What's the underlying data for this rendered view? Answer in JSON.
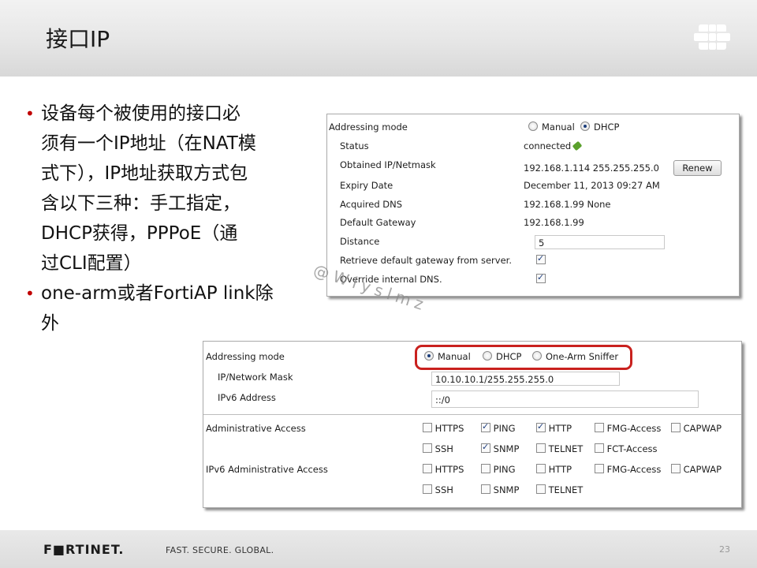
{
  "slide": {
    "title": "接口IP",
    "bullets": [
      "设备每个被使用的接口必须有一个IP地址（在NAT模式下），IP地址获取方式包含以下三种：手工指定，DHCP获得，PPPoE（通过CLI配置）",
      "one-arm或者FortiAP link除外"
    ],
    "bullet_lines": [
      [
        "设备每个被使用的接口必",
        "须有一个IP地址（在NAT模",
        "式下），IP地址获取方式包",
        "含以下三种：手工指定，",
        "DHCP获得，PPPoE（通",
        "过CLI配置）"
      ],
      [
        "one-arm或者FortiAP link除",
        "外"
      ]
    ],
    "watermark": "@Wlyslmz",
    "footer": {
      "brand": "F■RTINET.",
      "tagline": "FAST. SECURE. GLOBAL.",
      "page_number": "23"
    }
  },
  "dhcp_panel": {
    "addressing_mode_label": "Addressing mode",
    "mode_options": [
      "Manual",
      "DHCP"
    ],
    "selected_mode": "DHCP",
    "status_label": "Status",
    "status_value": "connected",
    "obtained_label": "Obtained IP/Netmask",
    "obtained_value": "192.168.1.114 255.255.255.0",
    "renew_button": "Renew",
    "expiry_label": "Expiry Date",
    "expiry_value": "December 11, 2013 09:27 AM",
    "dns_label": "Acquired DNS",
    "dns_value": "192.168.1.99 None",
    "gateway_label": "Default Gateway",
    "gateway_value": "192.168.1.99",
    "distance_label": "Distance",
    "distance_value": "5",
    "retrieve_label": "Retrieve default gateway from server.",
    "retrieve_checked": true,
    "override_label": "Override internal DNS.",
    "override_checked": true
  },
  "manual_panel": {
    "addressing_mode_label": "Addressing mode",
    "mode_options": [
      "Manual",
      "DHCP",
      "One-Arm Sniffer"
    ],
    "selected_mode": "Manual",
    "ip_label": "IP/Network Mask",
    "ip_value": "10.10.10.1/255.255.255.0",
    "ipv6_label": "IPv6 Address",
    "ipv6_value": "::/0",
    "admin_access_label": "Administrative Access",
    "admin_access": [
      {
        "name": "HTTPS",
        "checked": false
      },
      {
        "name": "PING",
        "checked": true
      },
      {
        "name": "HTTP",
        "checked": true
      },
      {
        "name": "FMG-Access",
        "checked": false
      },
      {
        "name": "CAPWAP",
        "checked": false
      },
      {
        "name": "SSH",
        "checked": false
      },
      {
        "name": "SNMP",
        "checked": true
      },
      {
        "name": "TELNET",
        "checked": false
      },
      {
        "name": "FCT-Access",
        "checked": false
      }
    ],
    "ipv6_admin_access_label": "IPv6 Administrative Access",
    "ipv6_admin_access": [
      {
        "name": "HTTPS",
        "checked": false
      },
      {
        "name": "PING",
        "checked": false
      },
      {
        "name": "HTTP",
        "checked": false
      },
      {
        "name": "FMG-Access",
        "checked": false
      },
      {
        "name": "CAPWAP",
        "checked": false
      },
      {
        "name": "SSH",
        "checked": false
      },
      {
        "name": "SNMP",
        "checked": false
      },
      {
        "name": "TELNET",
        "checked": false
      }
    ]
  },
  "colors": {
    "bullet": "#c00000",
    "highlight": "#c9211e"
  }
}
